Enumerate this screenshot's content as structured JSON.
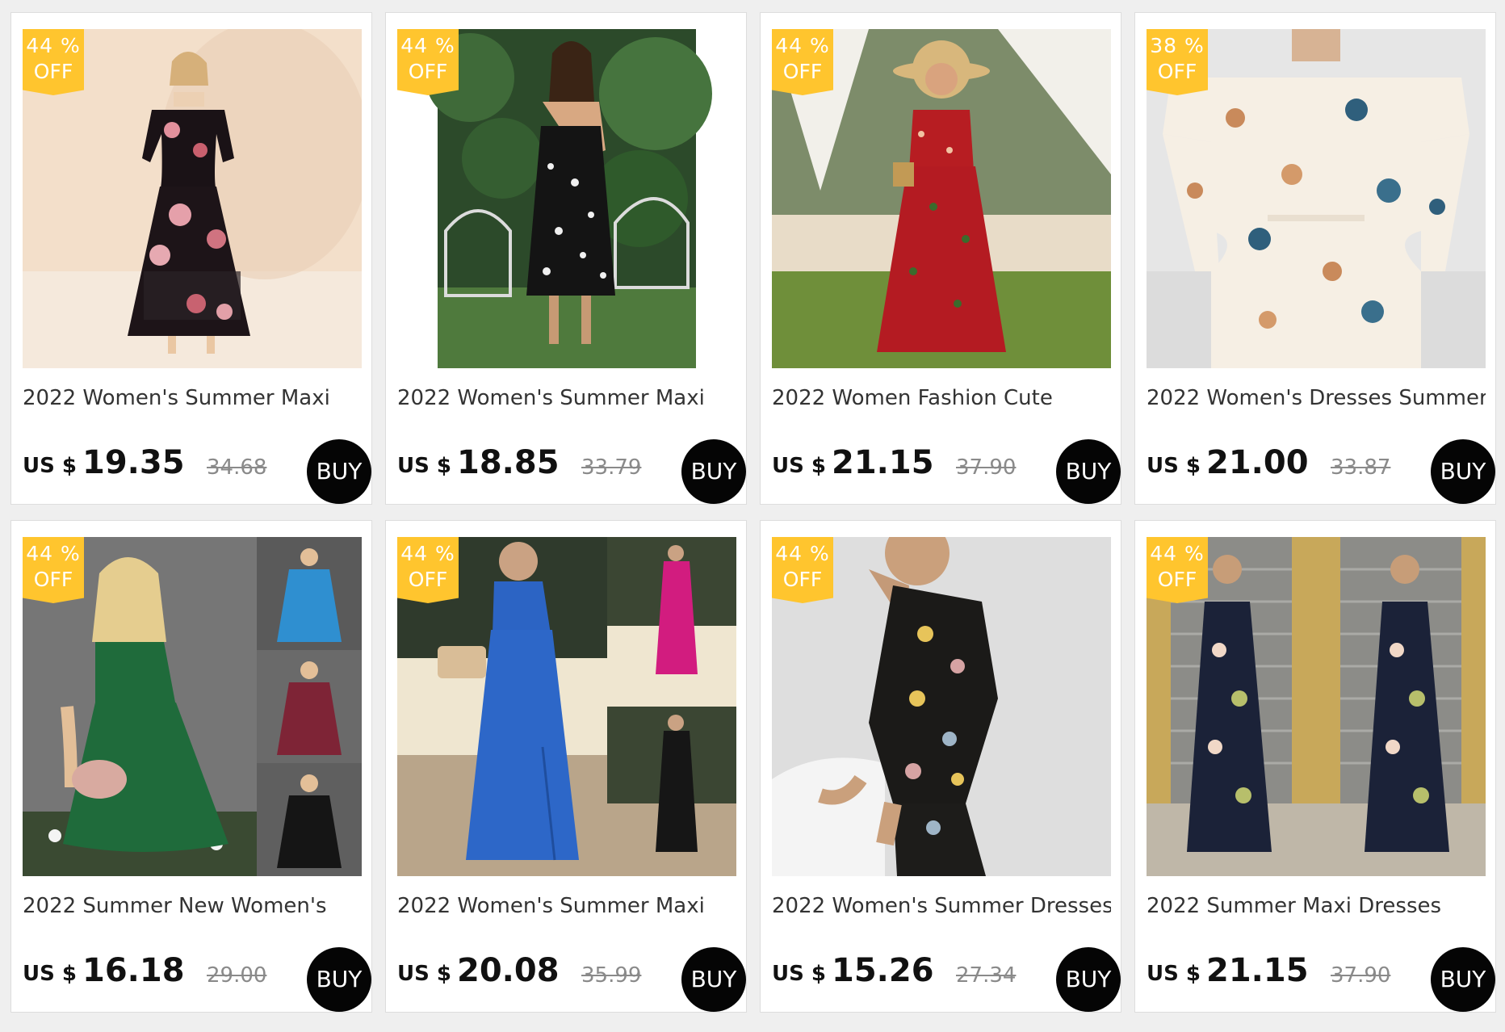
{
  "colors": {
    "badge": "#ffc52e",
    "buy_button": "#050505",
    "page_background": "#efefef"
  },
  "products": [
    {
      "discount_percent": "44 %",
      "discount_off": "OFF",
      "title": "2022 Women's Summer Maxi",
      "currency": "US $",
      "price": "19.35",
      "original_price": "34.68",
      "buy_label": "BUY",
      "image_name": "product-image-floral-off-shoulder-maxi"
    },
    {
      "discount_percent": "44 %",
      "discount_off": "OFF",
      "title": "2022 Women's Summer Maxi",
      "currency": "US $",
      "price": "18.85",
      "original_price": "33.79",
      "buy_label": "BUY",
      "image_name": "product-image-backless-floral-dress"
    },
    {
      "discount_percent": "44 %",
      "discount_off": "OFF",
      "title": "2022 Women Fashion Cute",
      "currency": "US $",
      "price": "21.15",
      "original_price": "37.90",
      "buy_label": "BUY",
      "image_name": "product-image-red-floral-maxi"
    },
    {
      "discount_percent": "38 %",
      "discount_off": "OFF",
      "title": "2022 Women's Dresses Summer",
      "currency": "US $",
      "price": "21.00",
      "original_price": "33.87",
      "buy_label": "BUY",
      "image_name": "product-image-off-shoulder-floral-mini"
    },
    {
      "discount_percent": "44 %",
      "discount_off": "OFF",
      "title": "2022 Summer New Women's",
      "currency": "US $",
      "price": "16.18",
      "original_price": "29.00",
      "buy_label": "BUY",
      "image_name": "product-image-one-shoulder-green-dress"
    },
    {
      "discount_percent": "44 %",
      "discount_off": "OFF",
      "title": "2022 Women's Summer Maxi",
      "currency": "US $",
      "price": "20.08",
      "original_price": "35.99",
      "buy_label": "BUY",
      "image_name": "product-image-blue-one-shoulder-maxi"
    },
    {
      "discount_percent": "44 %",
      "discount_off": "OFF",
      "title": "2022 Women's Summer Dresses",
      "currency": "US $",
      "price": "15.26",
      "original_price": "27.34",
      "buy_label": "BUY",
      "image_name": "product-image-halter-print-bodycon"
    },
    {
      "discount_percent": "44 %",
      "discount_off": "OFF",
      "title": "2022 Summer Maxi Dresses",
      "currency": "US $",
      "price": "21.15",
      "original_price": "37.90",
      "buy_label": "BUY",
      "image_name": "product-image-navy-floral-slip-maxi"
    }
  ]
}
